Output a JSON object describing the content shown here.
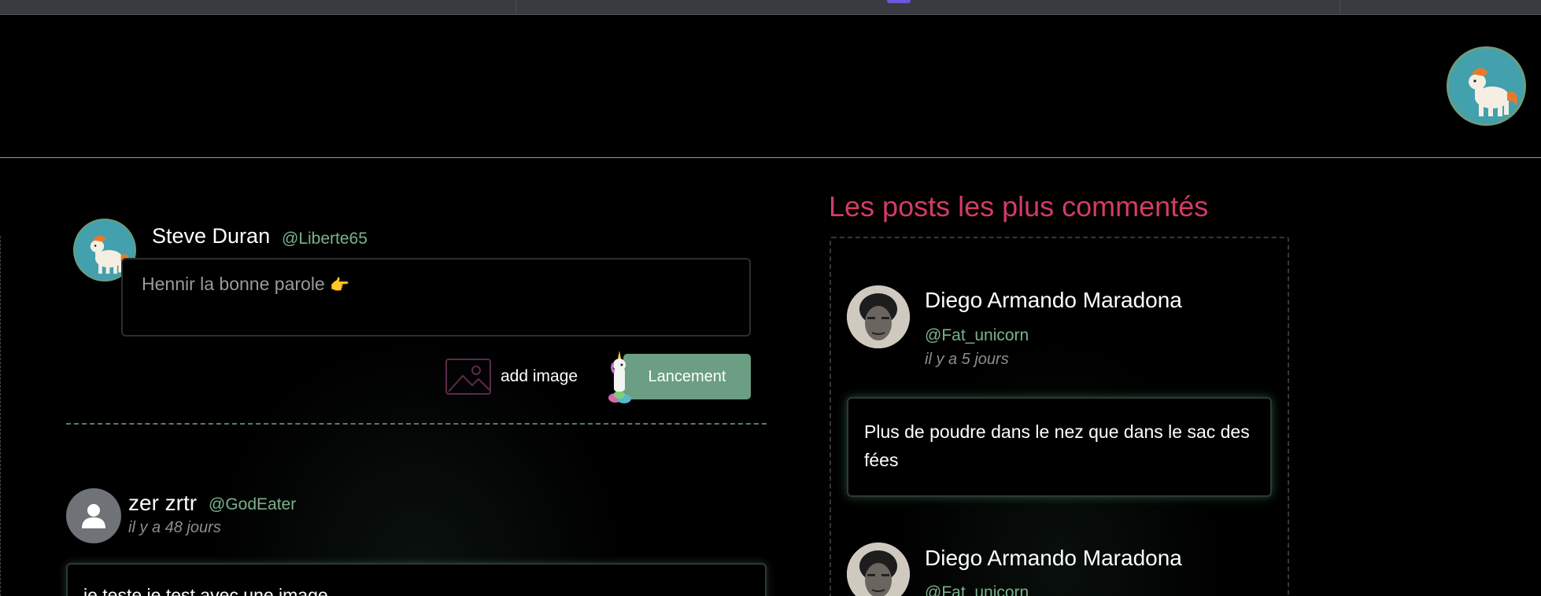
{
  "composer": {
    "name": "Steve Duran",
    "handle": "@Liberte65",
    "placeholder": "Hennir la bonne parole",
    "placeholder_emoji": "👉",
    "add_image_label": "add image",
    "submit_label": "Lancement"
  },
  "feed": {
    "posts": [
      {
        "name": "zer zrtr",
        "handle": "@GodEater",
        "time": "il y a 48 jours",
        "text": "je teste je test avec une image"
      }
    ]
  },
  "sidebar": {
    "title": "Les posts les plus commentés",
    "posts": [
      {
        "name": "Diego Armando Maradona",
        "handle": "@Fat_unicorn",
        "time": "il y a 5 jours",
        "text": "Plus de poudre dans le nez que dans le sac des fées"
      },
      {
        "name": "Diego Armando Maradona",
        "handle": "@Fat_unicorn"
      }
    ]
  },
  "colors": {
    "accent_green": "#6b9e82",
    "handle_green": "#7bb28c",
    "title_pink": "#d13c65",
    "background": "#000000"
  }
}
